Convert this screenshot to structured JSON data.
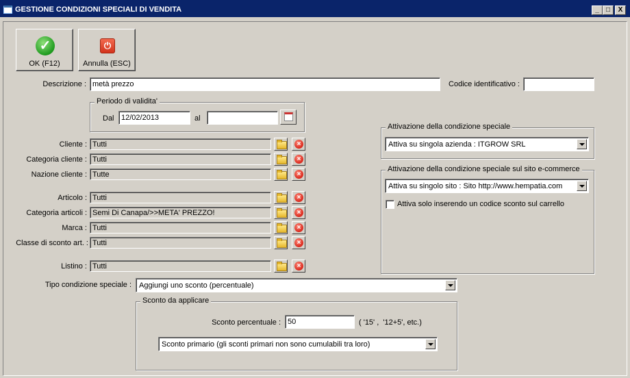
{
  "window": {
    "title": "GESTIONE CONDIZIONI SPECIALI DI VENDITA",
    "controls": {
      "minimize": "_",
      "maximize": "□",
      "close": "X"
    }
  },
  "toolbar": {
    "ok_label": "OK (F12)",
    "cancel_label": "Annulla (ESC)",
    "ok_icon": "check-icon",
    "cancel_icon": "power-icon"
  },
  "form": {
    "descrizione_label": "Descrizione :",
    "descrizione_value": "metà prezzo",
    "codice_label": "Codice identificativo :",
    "codice_value": "",
    "periodo": {
      "title": "Periodo di validita'",
      "dal_label": "Dal",
      "dal_value": "12/02/2013",
      "al_label": "al",
      "al_value": ""
    },
    "filters": [
      {
        "label": "Cliente :",
        "value": "Tutti"
      },
      {
        "label": "Categoria cliente :",
        "value": "Tutti"
      },
      {
        "label": "Nazione cliente :",
        "value": "Tutte"
      },
      {
        "label": "Articolo :",
        "value": "Tutti"
      },
      {
        "label": "Categoria articoli :",
        "value": "Semi Di Canapa/>>META' PREZZO!"
      },
      {
        "label": "Marca :",
        "value": "Tutti"
      },
      {
        "label": "Classe di sconto art. :",
        "value": "Tutti"
      },
      {
        "label": "Listino :",
        "value": "Tutti"
      }
    ],
    "tipo_label": "Tipo condizione speciale :",
    "tipo_value": "Aggiungi uno sconto (percentuale)",
    "sconto": {
      "title": "Sconto da applicare",
      "percent_label": "Sconto percentuale :",
      "percent_value": "50",
      "hint": "( '15' ,  '12+5', etc.)",
      "tipo_value": "Sconto primario (gli sconti primari non sono cumulabili tra loro)"
    },
    "attivazione": {
      "title": "Attivazione della condizione speciale",
      "value": "Attiva su singola azienda : ITGROW SRL"
    },
    "attivazione_sito": {
      "title": "Attivazione della condizione speciale sul sito e-commerce",
      "value": "Attiva su singolo sito : Sito http://www.hempatia.com",
      "checkbox_label": "Attiva solo inserendo un codice sconto sul carrello",
      "checkbox_checked": false
    }
  }
}
